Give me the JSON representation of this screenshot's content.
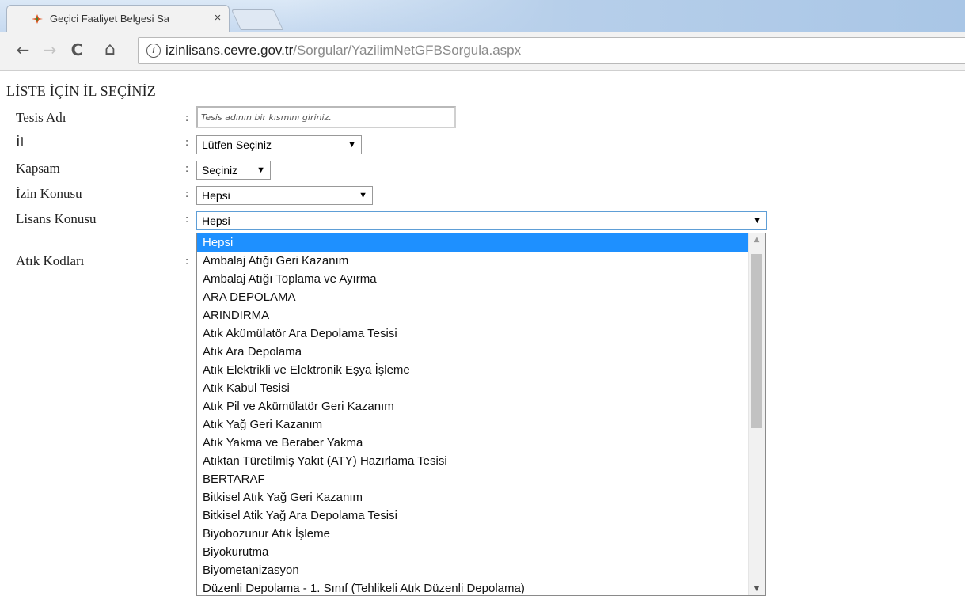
{
  "browser": {
    "tab_title": "Geçici Faaliyet Belgesi Sa",
    "tab_close": "×",
    "nav": {
      "back": "←",
      "forward": "→",
      "reload": "C",
      "home": "⌂"
    },
    "info_icon": "i",
    "url_host": "izinlisans.cevre.gov.tr",
    "url_path": "/Sorgular/YazilimNetGFBSorgula.aspx"
  },
  "page": {
    "heading": "LİSTE İÇİN İL SEÇİNİZ",
    "colon": ":",
    "fields": {
      "tesis_adi": {
        "label": "Tesis Adı",
        "placeholder": "Tesis adının bir kısmını giriniz."
      },
      "il": {
        "label": "İl",
        "value": "Lütfen Seçiniz"
      },
      "kapsam": {
        "label": "Kapsam",
        "value": "Seçiniz"
      },
      "izin_konusu": {
        "label": "İzin Konusu",
        "value": "Hepsi"
      },
      "lisans_konusu": {
        "label": "Lisans Konusu",
        "value": "Hepsi"
      },
      "atik_kodlari": {
        "label": "Atık Kodları"
      }
    },
    "select_arrow": "▼",
    "lisans_options": [
      "Hepsi",
      "Ambalaj Atığı Geri Kazanım",
      "Ambalaj Atığı Toplama ve Ayırma",
      "ARA DEPOLAMA",
      "ARINDIRMA",
      "Atık Akümülatör Ara Depolama Tesisi",
      "Atık Ara Depolama",
      "Atık Elektrikli ve Elektronik Eşya İşleme",
      "Atık Kabul Tesisi",
      "Atık Pil ve Akümülatör Geri Kazanım",
      "Atık Yağ Geri Kazanım",
      "Atık Yakma ve Beraber Yakma",
      "Atıktan Türetilmiş Yakıt (ATY) Hazırlama Tesisi",
      "BERTARAF",
      "Bitkisel Atık Yağ Geri Kazanım",
      "Bitkisel Atik Yağ Ara Depolama Tesisi",
      "Biyobozunur Atık İşleme",
      "Biyokurutma",
      "Biyometanizasyon",
      "Düzenli Depolama - 1. Sınıf (Tehlikeli Atık Düzenli Depolama)"
    ],
    "scroll_up": "▲",
    "scroll_down": "▼"
  }
}
